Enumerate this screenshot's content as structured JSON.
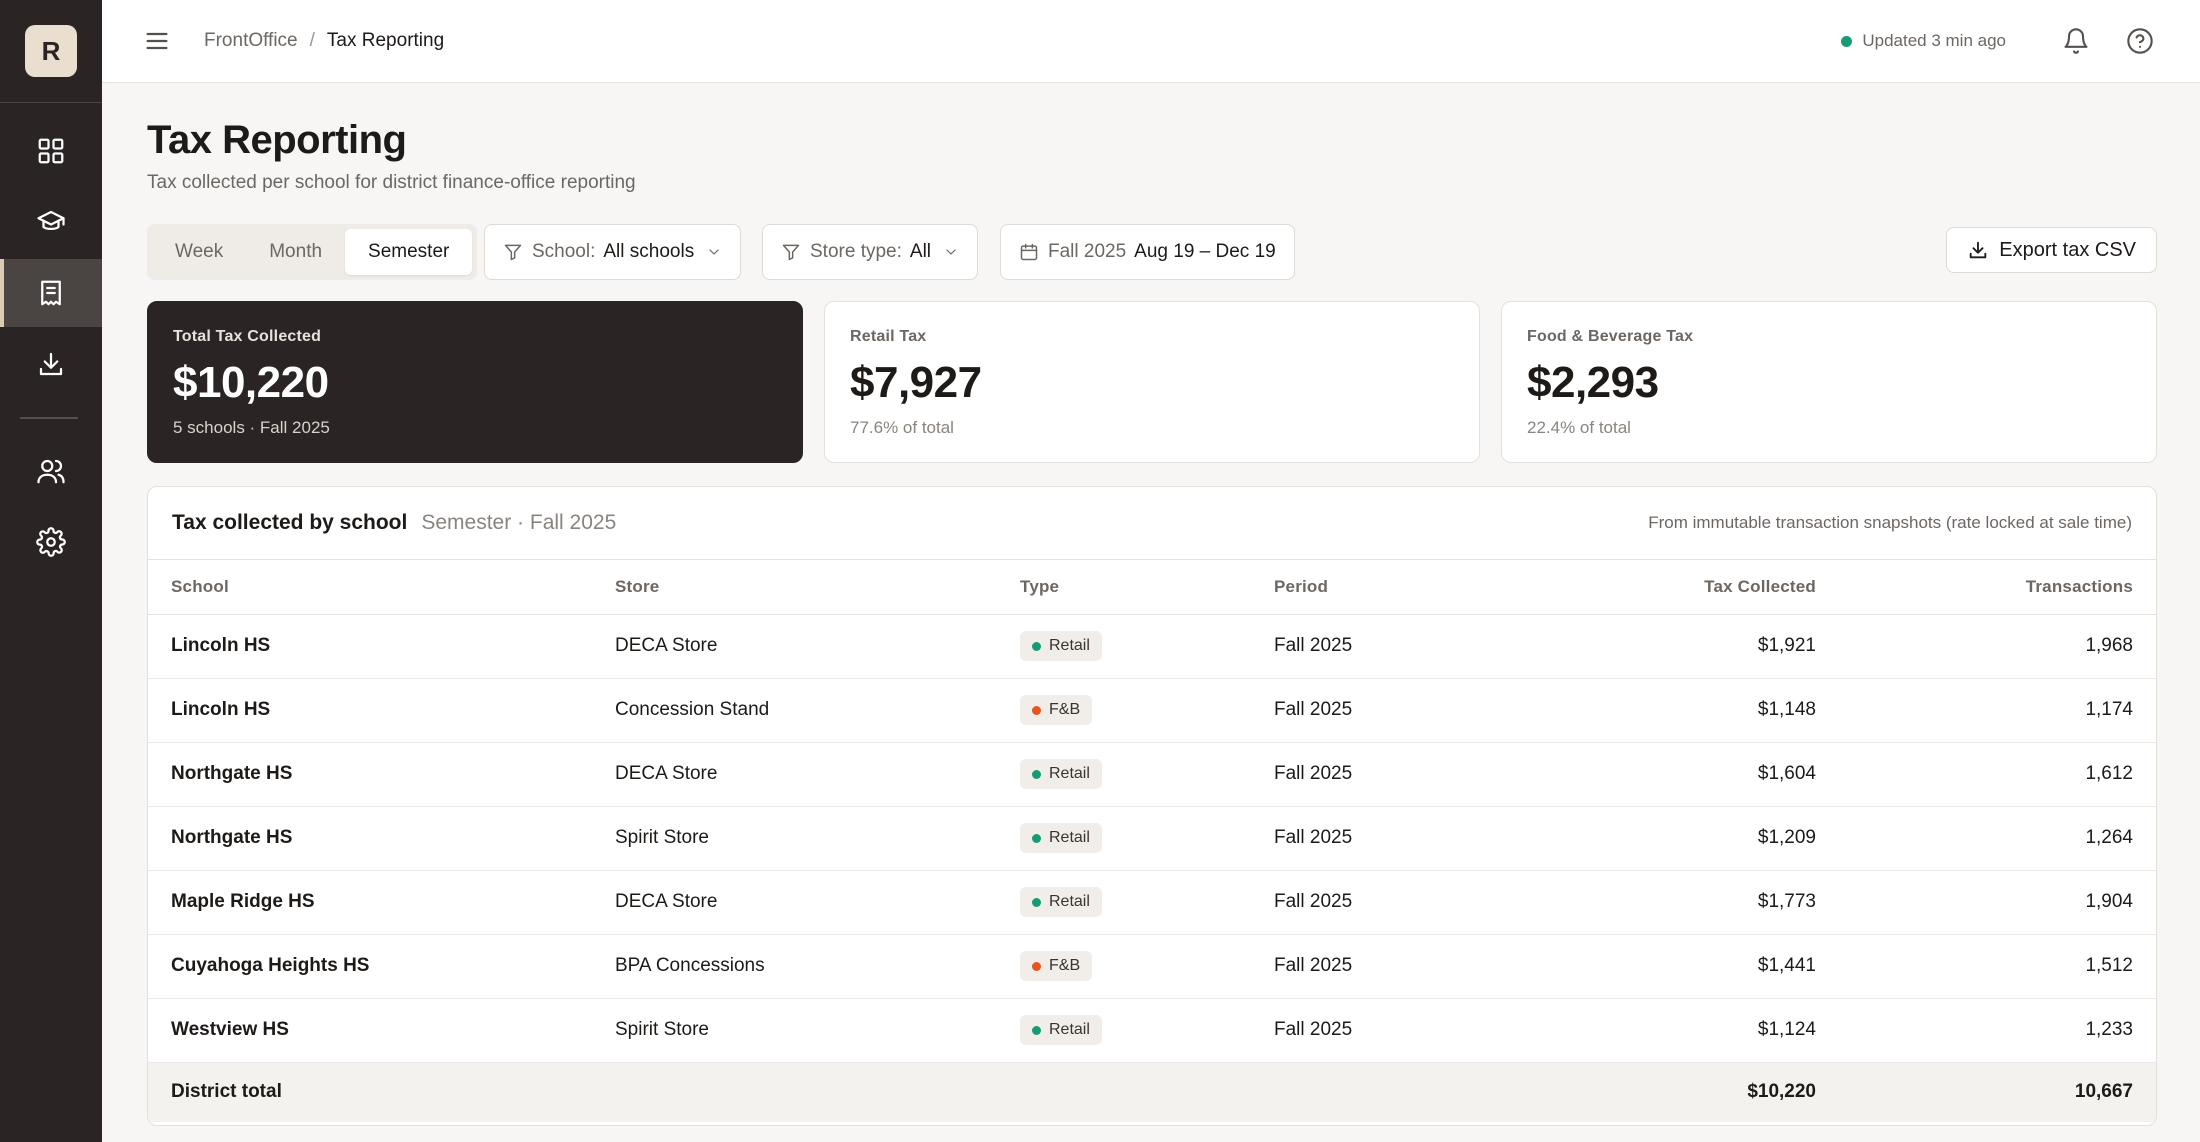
{
  "sidebar": {
    "logo_letter": "R",
    "items": [
      {
        "icon": "dashboard-grid-icon"
      },
      {
        "icon": "graduation-cap-icon"
      },
      {
        "icon": "receipt-icon",
        "active": true
      },
      {
        "icon": "download-icon"
      },
      {
        "icon": "users-icon"
      },
      {
        "icon": "gear-icon"
      }
    ]
  },
  "topbar": {
    "breadcrumb_root": "FrontOffice",
    "breadcrumb_sep": "/",
    "breadcrumb_current": "Tax Reporting",
    "updated_text": "Updated 3 min ago"
  },
  "page": {
    "title": "Tax Reporting",
    "subtitle": "Tax collected per school for district finance-office reporting"
  },
  "controls": {
    "periods": [
      "Week",
      "Month",
      "Semester"
    ],
    "active_period": "Semester",
    "school_filter_label": "School:",
    "school_filter_value": "All schools",
    "store_filter_label": "Store type:",
    "store_filter_value": "All",
    "date_term": "Fall 2025",
    "date_range": "Aug 19 – Dec 19",
    "export_label": "Export tax CSV"
  },
  "kpis": [
    {
      "label": "Total Tax Collected",
      "value": "$10,220",
      "sub": "5 schools · Fall 2025"
    },
    {
      "label": "Retail Tax",
      "value": "$7,927",
      "sub": "77.6% of total"
    },
    {
      "label": "Food & Beverage Tax",
      "value": "$2,293",
      "sub": "22.4% of total"
    }
  ],
  "table": {
    "title": "Tax collected by school",
    "meta": "Semester · Fall 2025",
    "note": "From immutable transaction snapshots (rate locked at sale time)",
    "columns": [
      "School",
      "Store",
      "Type",
      "Period",
      "Tax Collected",
      "Transactions"
    ],
    "rows": [
      {
        "school": "Lincoln HS",
        "store": "DECA Store",
        "type": "Retail",
        "period": "Fall 2025",
        "tax": "$1,921",
        "transactions": "1,968"
      },
      {
        "school": "Lincoln HS",
        "store": "Concession Stand",
        "type": "F&B",
        "period": "Fall 2025",
        "tax": "$1,148",
        "transactions": "1,174"
      },
      {
        "school": "Northgate HS",
        "store": "DECA Store",
        "type": "Retail",
        "period": "Fall 2025",
        "tax": "$1,604",
        "transactions": "1,612"
      },
      {
        "school": "Northgate HS",
        "store": "Spirit Store",
        "type": "Retail",
        "period": "Fall 2025",
        "tax": "$1,209",
        "transactions": "1,264"
      },
      {
        "school": "Maple Ridge HS",
        "store": "DECA Store",
        "type": "Retail",
        "period": "Fall 2025",
        "tax": "$1,773",
        "transactions": "1,904"
      },
      {
        "school": "Cuyahoga Heights HS",
        "store": "BPA Concessions",
        "type": "F&B",
        "period": "Fall 2025",
        "tax": "$1,441",
        "transactions": "1,512"
      },
      {
        "school": "Westview HS",
        "store": "Spirit Store",
        "type": "Retail",
        "period": "Fall 2025",
        "tax": "$1,124",
        "transactions": "1,233"
      }
    ],
    "total": {
      "label": "District total",
      "tax": "$10,220",
      "transactions": "10,667"
    }
  },
  "colors": {
    "retail_dot": "#1a9a74",
    "fnb_dot": "#e8541e",
    "status_dot": "#1a9a74",
    "sidebar_bg": "#2a2524"
  }
}
